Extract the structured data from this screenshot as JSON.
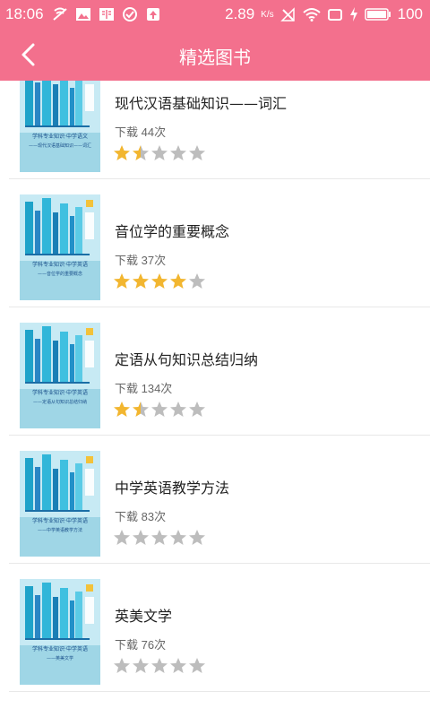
{
  "status": {
    "time": "18:06",
    "network_speed": "2.89",
    "speed_unit": "K/s",
    "battery": "100"
  },
  "nav": {
    "title": "精选图书"
  },
  "books": [
    {
      "title": "现代汉语基础知识——词汇",
      "downloads": "下载 44次",
      "rating": 1.5,
      "cover_title": "学科专业知识·中学语文",
      "cover_sub": "——现代汉语基础知识——词汇"
    },
    {
      "title": "音位学的重要概念",
      "downloads": "下载 37次",
      "rating": 4,
      "cover_title": "学科专业知识·中学英语",
      "cover_sub": "——音位学的重要概念"
    },
    {
      "title": "定语从句知识总结归纳",
      "downloads": "下载 134次",
      "rating": 1.5,
      "cover_title": "学科专业知识·中学英语",
      "cover_sub": "——定语从句知识总结归纳"
    },
    {
      "title": "中学英语教学方法",
      "downloads": "下载 83次",
      "rating": 0,
      "cover_title": "学科专业知识·中学英语",
      "cover_sub": "——中学英语教学方法"
    },
    {
      "title": "英美文学",
      "downloads": "下载 76次",
      "rating": 0,
      "cover_title": "学科专业知识·中学英语",
      "cover_sub": "——英美文学"
    }
  ],
  "colors": {
    "accent": "#f3708d",
    "star_on": "#f2b630",
    "star_off": "#bdbdbd"
  }
}
